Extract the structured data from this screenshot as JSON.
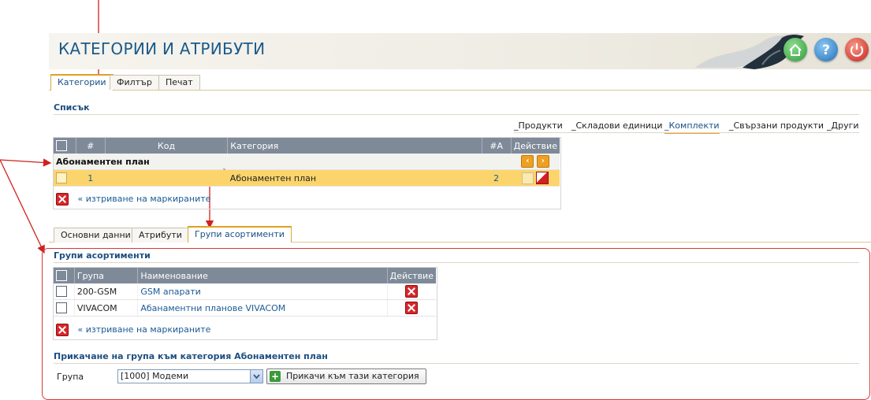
{
  "header": {
    "title": "КАТЕГОРИИ И АТРИБУТИ"
  },
  "top_tabs": [
    "Категории",
    "Филтър",
    "Печат"
  ],
  "list_section": {
    "title": "Списък"
  },
  "sublinks": [
    "_Продукти",
    "_Складови единици",
    "_Комплекти",
    "_Свързани продукти",
    "_Други"
  ],
  "category_table": {
    "headers": {
      "num": "#",
      "code": "Код",
      "category": "Категория",
      "count": "#А",
      "action": "Действие"
    },
    "group_label": "Абонаментен план",
    "row": {
      "num": "1",
      "category": "Абонаментен план",
      "count": "2"
    },
    "delete_marked": "« изтриване на маркираните"
  },
  "bottom_tabs": [
    "Основни данни",
    "Атрибути",
    "Групи асортименти"
  ],
  "assortment_section": {
    "title": "Групи асортименти",
    "headers": {
      "group": "Група",
      "name": "Наименование",
      "action": "Действие"
    },
    "rows": [
      {
        "group": "200-GSM",
        "name": "GSM апарати"
      },
      {
        "group": "VIVACOM",
        "name": "Абанаментни планове VIVACOM"
      }
    ],
    "delete_marked": "« изтриване на маркираните"
  },
  "attach_section": {
    "title": "Прикачане на група към категория Абонаментен план",
    "field_label": "Група",
    "select_value": "[1000] Модеми",
    "button_label": "Прикачи към тази категория"
  },
  "colors": {
    "accent": "#e0a020",
    "header_blue": "#1a5a8a",
    "annotation_red": "#d63a3a"
  }
}
